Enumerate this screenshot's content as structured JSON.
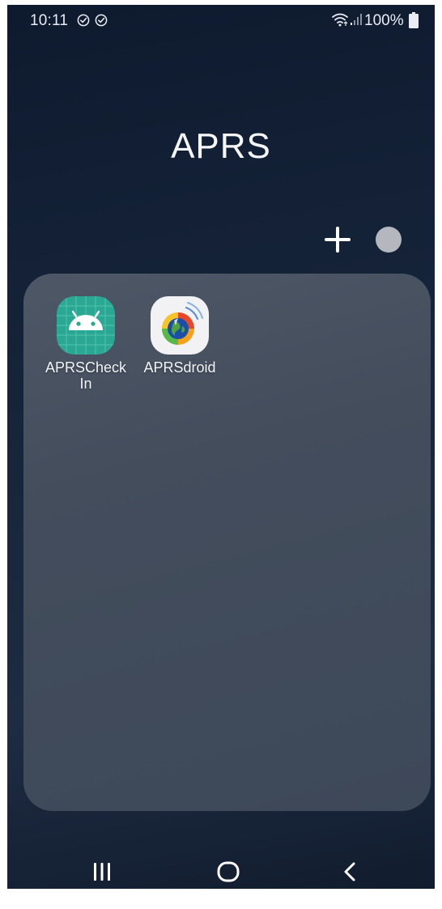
{
  "status_bar": {
    "time": "10:11",
    "battery_percent": "100%",
    "icons": [
      "check-circle-icon",
      "check-circle-icon",
      "wifi-icon",
      "signal-icon",
      "battery-icon"
    ]
  },
  "folder": {
    "title": "APRS",
    "actions": {
      "add_icon": "plus-icon",
      "color_icon": "color-dot-icon",
      "color_dot": "#b4b7bd"
    },
    "apps": [
      {
        "label_line1": "APRSCheck",
        "label_line2": "In",
        "icon": "android-icon",
        "icon_color": "#2ba893"
      },
      {
        "label_line1": "APRSdroid",
        "label_line2": "",
        "icon": "aprsdroid-globe-icon",
        "icon_color": "#f2f2f4"
      }
    ]
  },
  "nav_bar": {
    "recents_icon": "recents-icon",
    "home_icon": "home-icon",
    "back_icon": "back-icon"
  }
}
